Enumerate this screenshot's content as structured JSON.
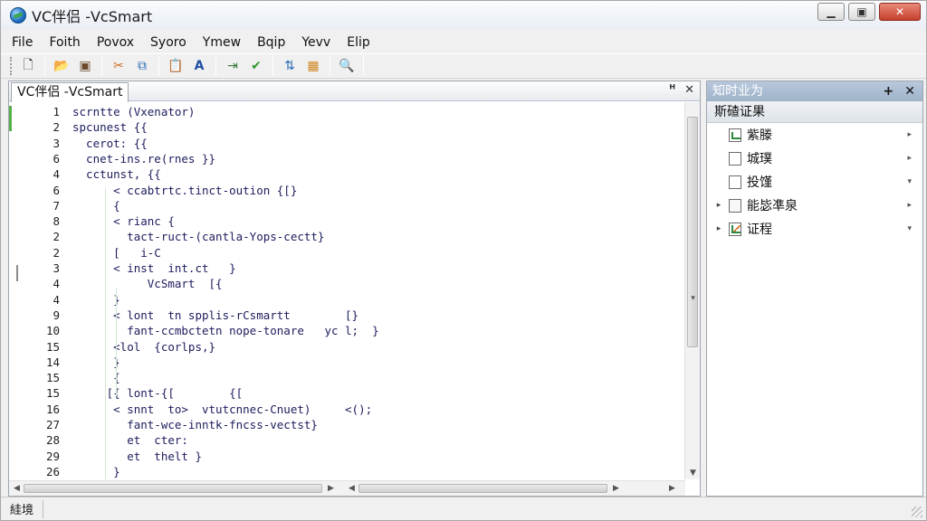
{
  "window": {
    "title": "VC伴侣 -VcSmart"
  },
  "window_controls": {
    "minimize": "▁",
    "maximize": "▣",
    "close": "✕"
  },
  "menu": [
    "File",
    "Foith",
    "Povox",
    "Syoro",
    "Ymew",
    "Bqip",
    "Yevv",
    "Elip"
  ],
  "toolbar": {
    "buttons": [
      {
        "name": "new-file-icon",
        "glyph": "🗋"
      },
      {
        "name": "open-folder-icon",
        "glyph": "📂"
      },
      {
        "name": "save-icon",
        "glyph": "▣"
      },
      {
        "name": "cut-icon",
        "glyph": "✂"
      },
      {
        "name": "copy-icon",
        "glyph": "⧉"
      },
      {
        "name": "paste-icon",
        "glyph": "📋"
      },
      {
        "name": "font-icon",
        "glyph": "A"
      },
      {
        "name": "indent-icon",
        "glyph": "⇥"
      },
      {
        "name": "check-icon",
        "glyph": "✔"
      },
      {
        "name": "sort-icon",
        "glyph": "⇅"
      },
      {
        "name": "grid-icon",
        "glyph": "▦"
      },
      {
        "name": "search-icon",
        "glyph": "🔍"
      }
    ]
  },
  "editor": {
    "tab_label": "VC伴侣 -VcSmart",
    "pin_label": "ᴴ",
    "close_label": "✕",
    "lines": [
      {
        "num": "1",
        "text": "scrntte (Vxenator)"
      },
      {
        "num": "2",
        "text": "spcunest {{"
      },
      {
        "num": "3",
        "text": "  cerot: {{"
      },
      {
        "num": "6",
        "text": "  cnet-ins.re(rnes }}"
      },
      {
        "num": "4",
        "text": "  cctunst, {{"
      },
      {
        "num": "6",
        "text": "      < ccabtrtc.tinct-oution {[}"
      },
      {
        "num": "7",
        "text": "      {"
      },
      {
        "num": "8",
        "text": "      < rianc {"
      },
      {
        "num": "2",
        "text": "        tact-ruct-(cantla-Yops-cectt}"
      },
      {
        "num": "2",
        "text": "      [   i-C"
      },
      {
        "num": "3",
        "text": "      < inst  int.ct   }"
      },
      {
        "num": "4",
        "text": "           VcSmart  [{"
      },
      {
        "num": "4",
        "text": "      }"
      },
      {
        "num": "9",
        "text": "      < lont  tn spplis-rCsmartt        [}"
      },
      {
        "num": "10",
        "text": "        fant-ccmbctetn nope-tonare   yc l;  }"
      },
      {
        "num": "15",
        "text": "      <lol  {corlps,}"
      },
      {
        "num": "14",
        "text": "      }"
      },
      {
        "num": "15",
        "text": "      {"
      },
      {
        "num": "15",
        "text": "     [{ lont-{[        {["
      },
      {
        "num": "16",
        "text": "      < snnt  to>  vtutcnnec-Cnuet)     <();"
      },
      {
        "num": "27",
        "text": "        fant-wce-inntk-fncss-vectst}"
      },
      {
        "num": "28",
        "text": "        et  cter:"
      },
      {
        "num": "29",
        "text": "        et  thelt }"
      },
      {
        "num": "26",
        "text": "      }"
      }
    ]
  },
  "side_panel": {
    "title": "知时业为",
    "add_label": "+",
    "close_label": "✕",
    "subheader": "斯碴证果",
    "items": [
      {
        "label": "紫滕",
        "icon": "chart-icon",
        "expander": "",
        "arrow": "▸"
      },
      {
        "label": "城璞",
        "icon": "document-icon",
        "expander": "",
        "arrow": "▸"
      },
      {
        "label": "投馑",
        "icon": "document-icon",
        "expander": "",
        "arrow": "▾"
      },
      {
        "label": "能毖凖泉",
        "icon": "document-icon",
        "expander": "▸",
        "arrow": "▸"
      },
      {
        "label": "证程",
        "icon": "chart-icon",
        "expander": "▸",
        "arrow": "▾"
      }
    ]
  },
  "status": {
    "text": "絓境"
  }
}
